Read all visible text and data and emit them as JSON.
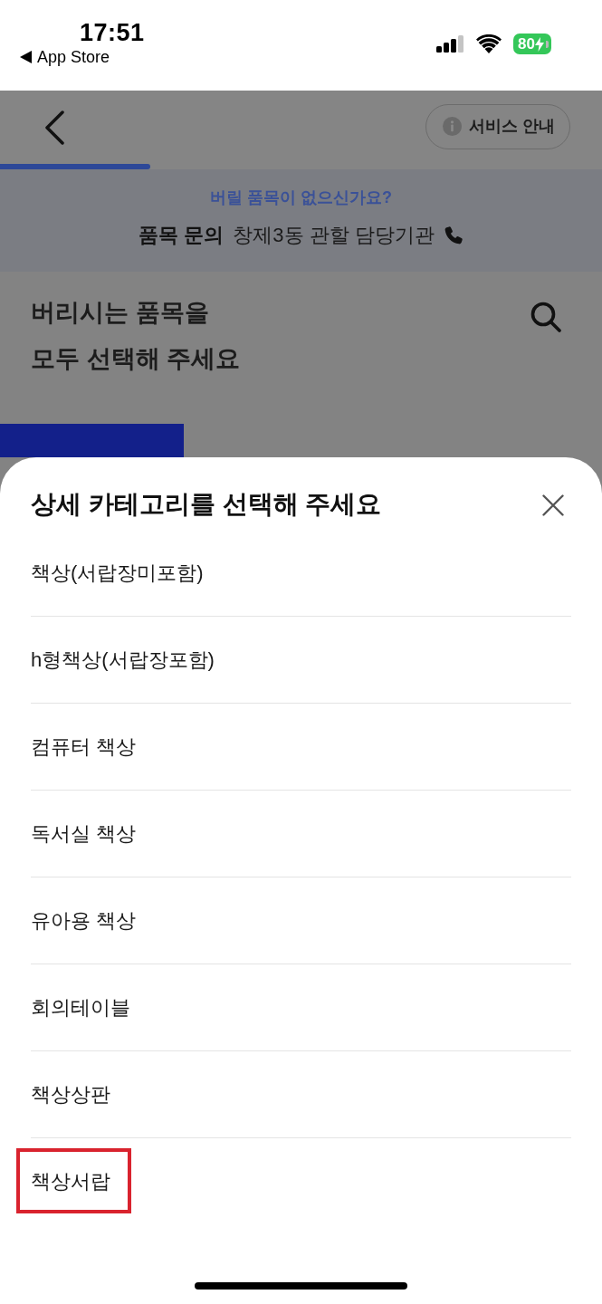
{
  "status_bar": {
    "time": "17:51",
    "back_label": "App Store",
    "battery": "80"
  },
  "header": {
    "service_button": "서비스 안내",
    "progress": {
      "level": 0.25
    }
  },
  "banner": {
    "question": "버릴 품목이 없으신가요?",
    "inquiry_label": "품목 문의",
    "inquiry_target": "창제3동 관할 담당기관"
  },
  "page_title": "버리시는 품목을\n모두 선택해 주세요",
  "sheet": {
    "title": "상세 카테고리를 선택해 주세요",
    "categories": [
      {
        "label": "책상(서랍장미포함)",
        "highlighted": false
      },
      {
        "label": "h형책상(서랍장포함)",
        "highlighted": false
      },
      {
        "label": "컴퓨터 책상",
        "highlighted": false
      },
      {
        "label": "독서실 책상",
        "highlighted": false
      },
      {
        "label": "유아용 책상",
        "highlighted": false
      },
      {
        "label": "회의테이블",
        "highlighted": false
      },
      {
        "label": "책상상판",
        "highlighted": false
      },
      {
        "label": "책상서랍",
        "highlighted": true
      }
    ]
  }
}
